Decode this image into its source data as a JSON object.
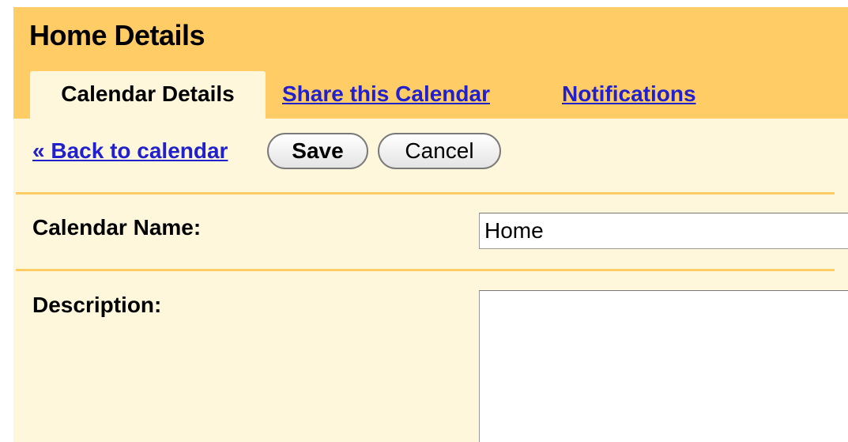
{
  "header": {
    "title": "Home Details",
    "tabs": [
      {
        "label": "Calendar Details",
        "active": true
      },
      {
        "label": "Share this Calendar",
        "active": false
      },
      {
        "label": "Notifications",
        "active": false
      }
    ]
  },
  "toolbar": {
    "back_label": "« Back to calendar",
    "save_label": "Save",
    "cancel_label": "Cancel"
  },
  "form": {
    "name_label": "Calendar Name:",
    "name_value": "Home",
    "description_label": "Description:",
    "description_value": ""
  },
  "colors": {
    "header_bg": "#ffcc66",
    "panel_bg": "#fff7dc",
    "link": "#2020cc"
  }
}
